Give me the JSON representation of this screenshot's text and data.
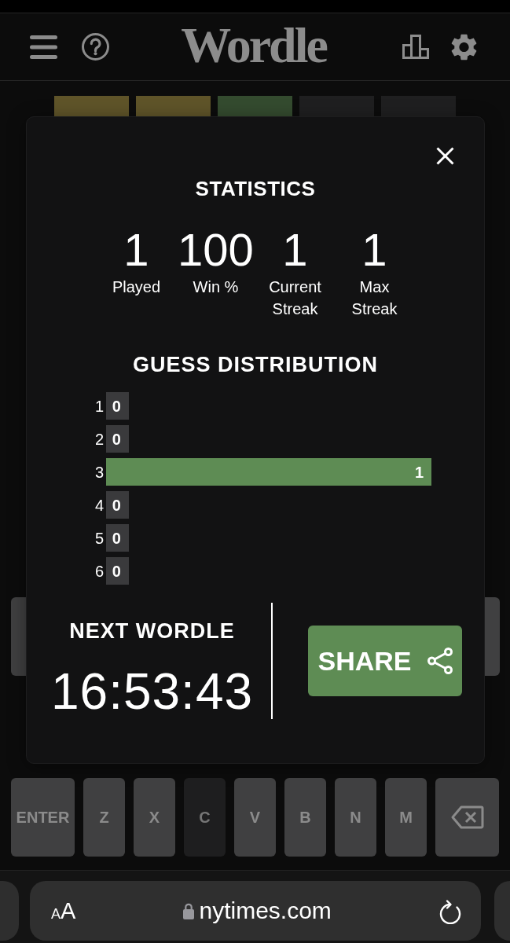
{
  "header": {
    "title": "Wordle"
  },
  "board": {
    "tiles": [
      {
        "kind": "present"
      },
      {
        "kind": "present"
      },
      {
        "kind": "correct"
      },
      {
        "kind": "absent"
      },
      {
        "kind": "absent"
      }
    ]
  },
  "statistics_modal": {
    "title": "STATISTICS",
    "stats": [
      {
        "value": "1",
        "label": "Played"
      },
      {
        "value": "100",
        "label": "Win %"
      },
      {
        "value": "1",
        "label": "Current Streak"
      },
      {
        "value": "1",
        "label": "Max Streak"
      }
    ],
    "distribution_title": "GUESS DISTRIBUTION",
    "distribution": [
      {
        "guess": "1",
        "count": "0",
        "current": false
      },
      {
        "guess": "2",
        "count": "0",
        "current": false
      },
      {
        "guess": "3",
        "count": "1",
        "current": true
      },
      {
        "guess": "4",
        "count": "0",
        "current": false
      },
      {
        "guess": "5",
        "count": "0",
        "current": false
      },
      {
        "guess": "6",
        "count": "0",
        "current": false
      }
    ],
    "next_title": "NEXT WORDLE",
    "countdown": "16:53:43",
    "share_button": "SHARE"
  },
  "keyboard": {
    "edge_keys": [
      {
        "absent": false
      },
      {
        "absent": false
      }
    ],
    "bottom_row": [
      {
        "kind": "enter",
        "label": "ENTER",
        "absent": false
      },
      {
        "kind": "letter",
        "label": "Z",
        "absent": false
      },
      {
        "kind": "letter",
        "label": "X",
        "absent": false
      },
      {
        "kind": "letter",
        "label": "C",
        "absent": true
      },
      {
        "kind": "letter",
        "label": "V",
        "absent": false
      },
      {
        "kind": "letter",
        "label": "B",
        "absent": false
      },
      {
        "kind": "letter",
        "label": "N",
        "absent": false
      },
      {
        "kind": "letter",
        "label": "M",
        "absent": false
      },
      {
        "kind": "backspace",
        "absent": false
      }
    ]
  },
  "browser": {
    "text_size_button": "AA",
    "url": "nytimes.com"
  }
}
